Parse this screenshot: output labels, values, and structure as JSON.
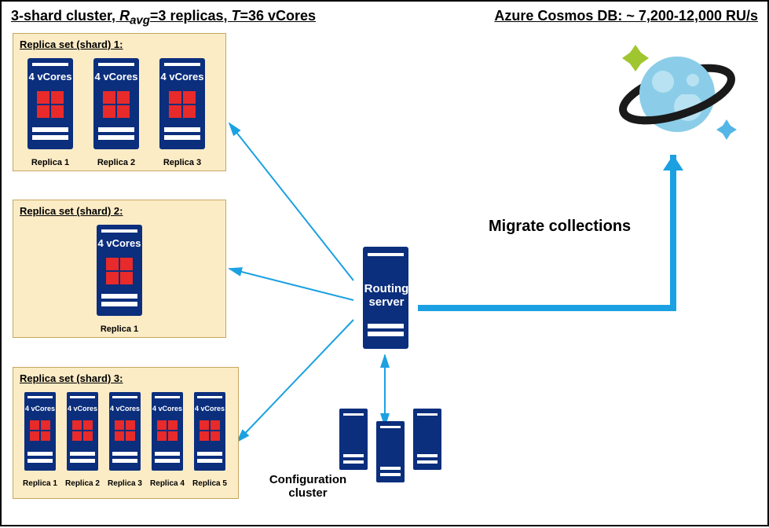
{
  "title_left_prefix": "3-shard cluster, ",
  "title_left_ravg": "R",
  "title_left_ravg_sub": "avg",
  "title_left_mid": "=3 replicas, ",
  "title_left_t": "T",
  "title_left_suffix": "=36 vCores",
  "title_right": "Azure Cosmos DB: ~ 7,200-12,000 RU/s",
  "shard1": {
    "title": "Replica set (shard) 1:",
    "vcores": "4 vCores",
    "replicas": [
      "Replica 1",
      "Replica 2",
      "Replica 3"
    ]
  },
  "shard2": {
    "title": "Replica set (shard) 2:",
    "vcores": "4 vCores",
    "replicas": [
      "Replica 1"
    ]
  },
  "shard3": {
    "title": "Replica set (shard) 3:",
    "vcores": "4 vCores",
    "replicas": [
      "Replica 1",
      "Replica 2",
      "Replica 3",
      "Replica 4",
      "Replica 5"
    ]
  },
  "routing_label": "Routing server",
  "config_label": "Configuration cluster",
  "migrate_label": "Migrate collections",
  "cosmos_icon_name": "cosmos-db-icon",
  "colors": {
    "arrow": "#1ba1e2",
    "server": "#0b2e7d",
    "core": "#e82a2a",
    "shard_bg": "#fcecc6"
  }
}
